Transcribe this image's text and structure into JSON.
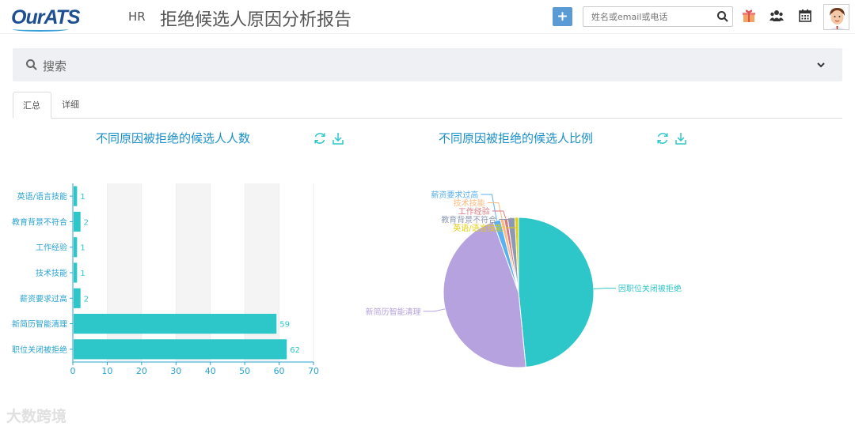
{
  "header": {
    "logo": "OurATS",
    "role": "HR",
    "page_title": "拒绝候选人原因分析报告",
    "search_placeholder": "姓名或email或电话"
  },
  "filter": {
    "search_label": "搜索"
  },
  "tabs": [
    {
      "label": "汇总"
    },
    {
      "label": "详细"
    }
  ],
  "watermark": "大数跨境",
  "charts": {
    "bar_title": "不同原因被拒绝的候选人人数",
    "pie_title": "不同原因被拒绝的候选人比例"
  },
  "chart_data": [
    {
      "type": "bar",
      "orientation": "horizontal",
      "title": "不同原因被拒绝的候选人人数",
      "categories": [
        "英语/语言技能",
        "教育背景不符合",
        "工作经验",
        "技术技能",
        "薪资要求过高",
        "新简历智能清理",
        "职位关闭被拒绝"
      ],
      "values": [
        1,
        2,
        1,
        1,
        2,
        59,
        62
      ],
      "xlim": [
        0,
        70
      ],
      "xticks": [
        0,
        10,
        20,
        30,
        40,
        50,
        60,
        70
      ],
      "color": "#2ec7c9",
      "grid": true
    },
    {
      "type": "pie",
      "title": "不同原因被拒绝的候选人比例",
      "slices": [
        {
          "label": "因职位关闭被拒绝",
          "value": 62,
          "color": "#2ec7c9"
        },
        {
          "label": "新简历智能清理",
          "value": 59,
          "color": "#b6a2de"
        },
        {
          "label": "薪资要求过高",
          "value": 2,
          "color": "#5ab1ef"
        },
        {
          "label": "技术技能",
          "value": 1,
          "color": "#ffb980"
        },
        {
          "label": "工作经验",
          "value": 1,
          "color": "#d87a80"
        },
        {
          "label": "教育背景不符合",
          "value": 2,
          "color": "#8d98b3"
        },
        {
          "label": "英语/语言技能",
          "value": 1,
          "color": "#e5cf0d"
        }
      ]
    }
  ]
}
